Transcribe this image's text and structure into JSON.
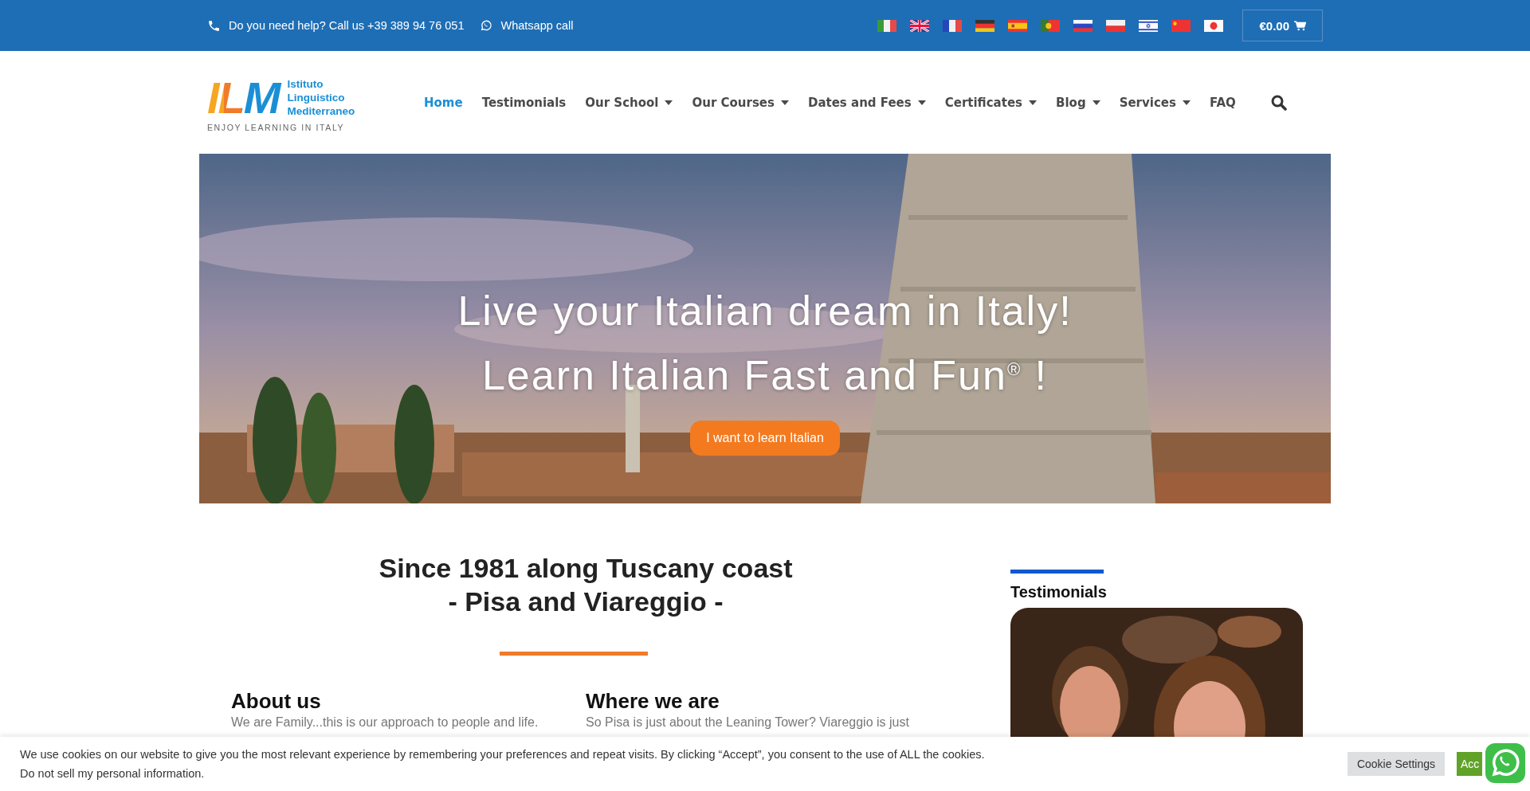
{
  "top_bar": {
    "help": "Do you need help? Call us +39 389 94 76 051",
    "whatsapp": "Whatsapp call",
    "cart_total": "€0.00"
  },
  "logo": {
    "mark": "ILM",
    "name_lines": [
      "Istituto",
      "Linguistico",
      "Mediterraneo"
    ],
    "tagline": "ENJOY LEARNING IN ITALY"
  },
  "nav": [
    {
      "label": "Home",
      "selected": true,
      "dropdown": false
    },
    {
      "label": "Testimonials",
      "selected": false,
      "dropdown": false
    },
    {
      "label": "Our School",
      "selected": false,
      "dropdown": true
    },
    {
      "label": "Our Courses",
      "selected": false,
      "dropdown": true
    },
    {
      "label": "Dates and Fees",
      "selected": false,
      "dropdown": true
    },
    {
      "label": "Certificates",
      "selected": false,
      "dropdown": true
    },
    {
      "label": "Blog",
      "selected": false,
      "dropdown": true
    },
    {
      "label": "Services",
      "selected": false,
      "dropdown": true
    },
    {
      "label": "FAQ",
      "selected": false,
      "dropdown": false
    }
  ],
  "hero": {
    "line_1": "Live your Italian dream in Italy!",
    "line_2": "Learn Italian Fast and Fun$^{®}$ !",
    "button": "I want to learn Italian"
  },
  "intro": {
    "heading_lines": [
      "Since 1981 along Tuscany coast",
      "- Pisa and Viareggio -"
    ],
    "columns": [
      {
        "title": "About us",
        "text": "We are Family...this is our approach to people and life."
      },
      {
        "title": "Where we are",
        "text": "So Pisa is just about the Leaning Tower? Viareggio is just"
      }
    ]
  },
  "testimonials": {
    "title": "Testimonials"
  },
  "cookie_bar": {
    "text": "We use cookies on our website to give you the most relevant experience by remembering your preferences and repeat visits. By clicking “Accept”, you consent to the use of ALL the cookies.",
    "link": "Do not sell my personal information.",
    "settings_button": "Cookie Settings",
    "accept_button": "Acc"
  }
}
